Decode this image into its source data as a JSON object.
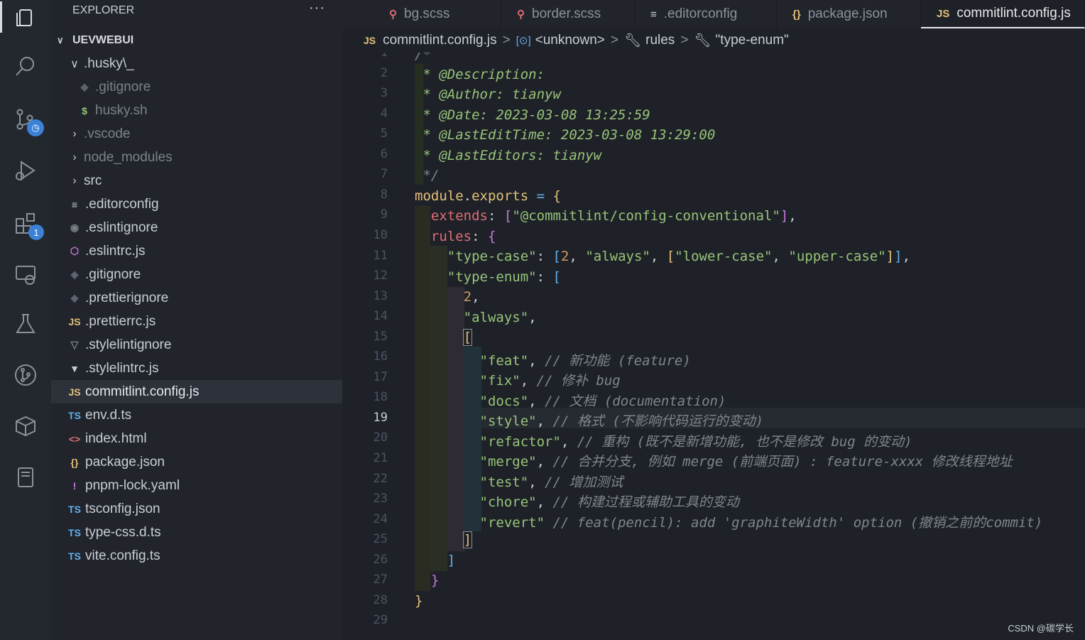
{
  "sidebar": {
    "title": "EXPLORER",
    "more": "···",
    "section": "UEVWEBUI",
    "items": [
      {
        "label": ".husky\\_",
        "icon": "chevron-down",
        "indent": 1,
        "dim": false
      },
      {
        "label": ".gitignore",
        "icon": "git-icon",
        "indent": 2,
        "dim": true
      },
      {
        "label": "husky.sh",
        "icon": "$",
        "indent": 2,
        "dim": true
      },
      {
        "label": ".vscode",
        "icon": "chevron-right",
        "indent": 1,
        "dim": true
      },
      {
        "label": "node_modules",
        "icon": "chevron-right",
        "indent": 1,
        "dim": true
      },
      {
        "label": "src",
        "icon": "chevron-right",
        "indent": 1,
        "dim": false
      },
      {
        "label": ".editorconfig",
        "icon": "≡",
        "indent": 1,
        "dim": false
      },
      {
        "label": ".eslintignore",
        "icon": "◉",
        "indent": 1,
        "dim": false
      },
      {
        "label": ".eslintrc.js",
        "icon": "⬡",
        "indent": 1,
        "dim": false
      },
      {
        "label": ".gitignore",
        "icon": "◆",
        "indent": 1,
        "dim": false
      },
      {
        "label": ".prettierignore",
        "icon": "◆",
        "indent": 1,
        "dim": false
      },
      {
        "label": ".prettierrc.js",
        "icon": "JS",
        "indent": 1,
        "dim": false
      },
      {
        "label": ".stylelintignore",
        "icon": "▽",
        "indent": 1,
        "dim": false
      },
      {
        "label": ".stylelintrc.js",
        "icon": "▼",
        "indent": 1,
        "dim": false
      },
      {
        "label": "commitlint.config.js",
        "icon": "JS",
        "indent": 1,
        "dim": false,
        "selected": true
      },
      {
        "label": "env.d.ts",
        "icon": "TS",
        "indent": 1,
        "dim": false
      },
      {
        "label": "index.html",
        "icon": "<>",
        "indent": 1,
        "dim": false
      },
      {
        "label": "package.json",
        "icon": "{}",
        "indent": 1,
        "dim": false
      },
      {
        "label": "pnpm-lock.yaml",
        "icon": "!",
        "indent": 1,
        "dim": false
      },
      {
        "label": "tsconfig.json",
        "icon": "TS",
        "indent": 1,
        "dim": false
      },
      {
        "label": "type-css.d.ts",
        "icon": "TS",
        "indent": 1,
        "dim": false
      },
      {
        "label": "vite.config.ts",
        "icon": "TS",
        "indent": 1,
        "dim": false
      }
    ]
  },
  "activity": {
    "extensions_badge": "1"
  },
  "tabs": [
    {
      "label": "bg.scss",
      "icon": "⚲"
    },
    {
      "label": "border.scss",
      "icon": "⚲"
    },
    {
      "label": ".editorconfig",
      "icon": "≡"
    },
    {
      "label": "package.json",
      "icon": "{}"
    },
    {
      "label": "commitlint.config.js",
      "icon": "JS",
      "active": true
    }
  ],
  "breadcrumb": {
    "file_icon": "JS",
    "file": "commitlint.config.js",
    "symbol1": "<unknown>",
    "symbol2": "rules",
    "symbol3": "\"type-enum\""
  },
  "editor": {
    "current_line": 19,
    "line_count": 29
  },
  "watermark": "CSDN @碳学长",
  "colors": {
    "keyword": "#e06c75",
    "string": "#98c379",
    "number": "#d19a66",
    "comment": "#7f848e",
    "bracket1": "#e5c07b",
    "bracket2": "#c678dd",
    "bracket3": "#61afef"
  }
}
